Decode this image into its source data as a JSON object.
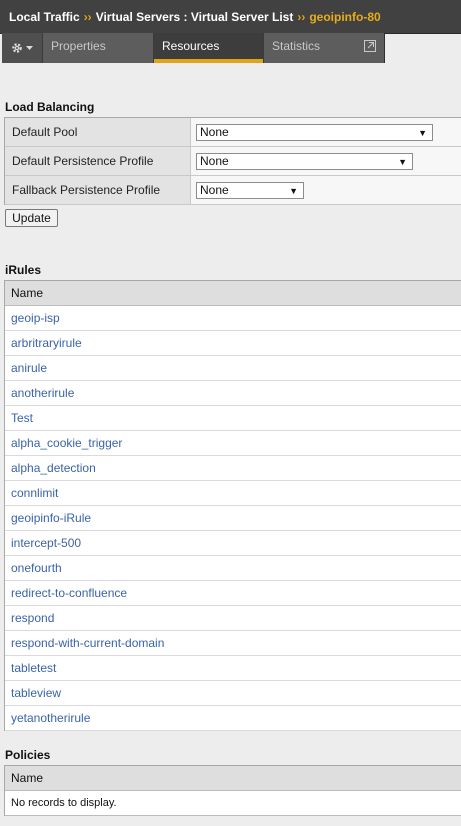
{
  "breadcrumb": {
    "item1": "Local Traffic",
    "item2": "Virtual Servers : Virtual Server List",
    "current": "geoipinfo-80",
    "separator": "››"
  },
  "tabs": {
    "properties": "Properties",
    "resources": "Resources",
    "statistics": "Statistics"
  },
  "load_balancing": {
    "title": "Load Balancing",
    "rows": [
      {
        "label": "Default Pool",
        "value": "None"
      },
      {
        "label": "Default Persistence Profile",
        "value": "None"
      },
      {
        "label": "Fallback Persistence Profile",
        "value": "None"
      }
    ],
    "update_label": "Update"
  },
  "irules": {
    "title": "iRules",
    "column": "Name",
    "items": [
      "geoip-isp",
      "arbritraryirule",
      "anirule",
      "anotherirule",
      "Test",
      "alpha_cookie_trigger",
      "alpha_detection",
      "connlimit",
      "geoipinfo-iRule",
      "intercept-500",
      "onefourth",
      "redirect-to-confluence",
      "respond",
      "respond-with-current-domain",
      "tabletest",
      "tableview",
      "yetanotherirule"
    ]
  },
  "policies": {
    "title": "Policies",
    "column": "Name",
    "empty_text": "No records to display."
  },
  "colors": {
    "accent": "#e6ac1b",
    "link": "#3a63a8",
    "header_bg": "#414141"
  }
}
